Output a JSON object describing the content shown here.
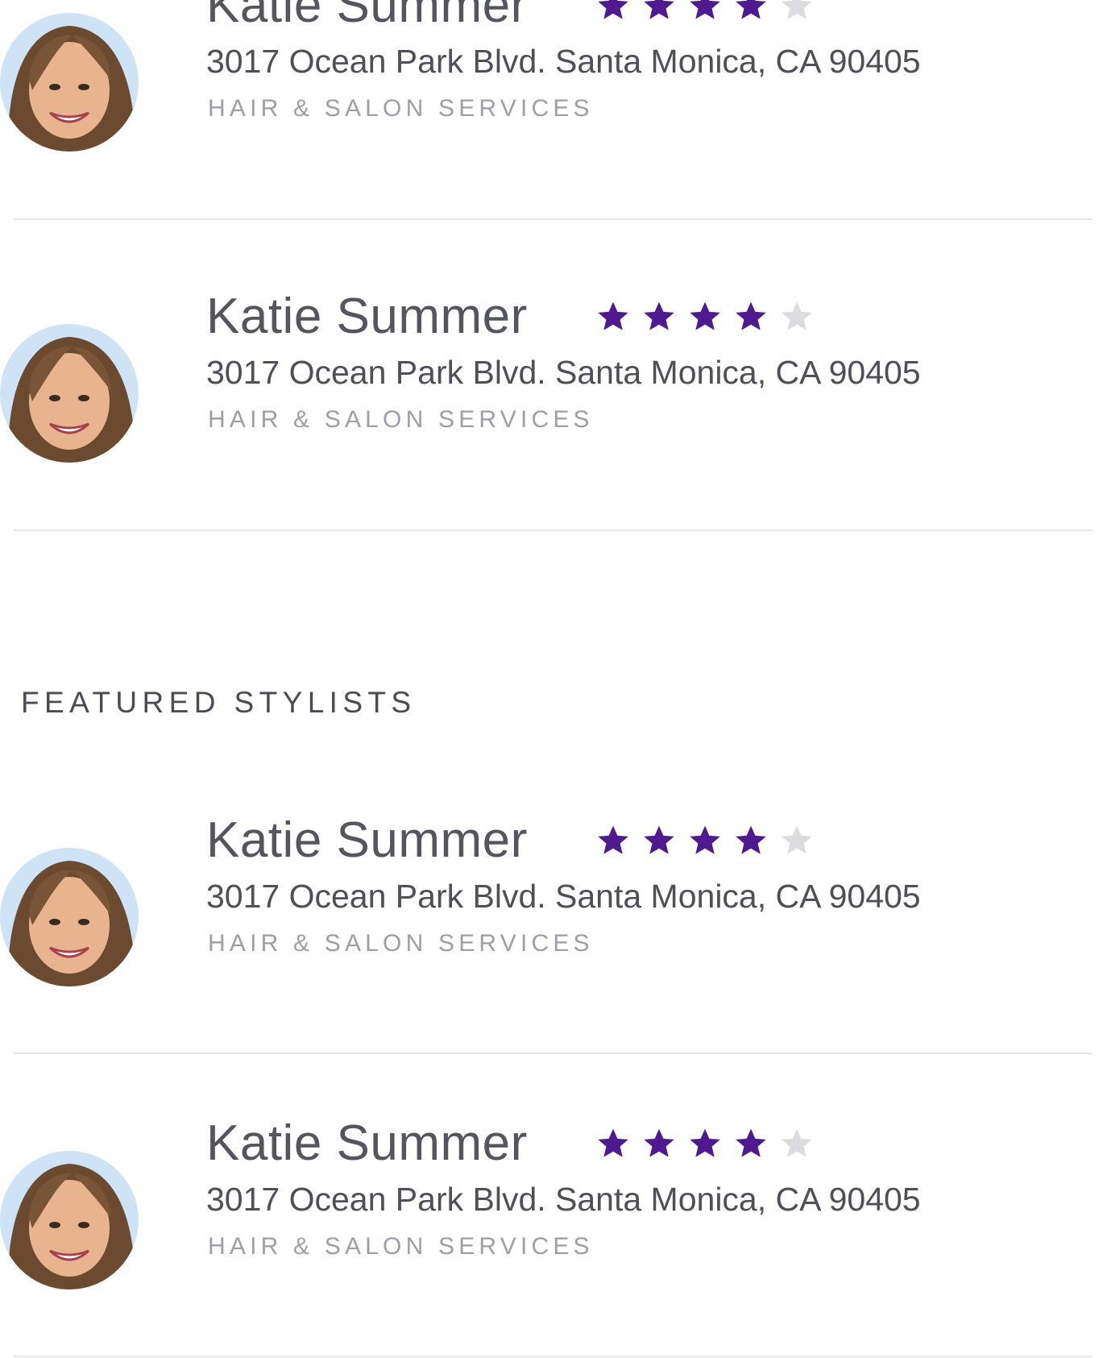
{
  "section_title": "FEATURED STYLISTS",
  "colors": {
    "star_filled": "#4f1990",
    "star_empty": "#dcdce0",
    "text_primary": "#55555e",
    "text_muted": "#9e9ea6",
    "divider": "#e6e6ea"
  },
  "top_list": {
    "items": [
      {
        "name": "Katie Summer",
        "rating": 4,
        "rating_max": 5,
        "address": "3017 Ocean Park Blvd. Santa Monica, CA 90405",
        "category": "HAIR & SALON SERVICES",
        "avatar_icon": "avatar-photo"
      },
      {
        "name": "Katie Summer",
        "rating": 4,
        "rating_max": 5,
        "address": "3017 Ocean Park Blvd. Santa Monica, CA 90405",
        "category": "HAIR & SALON SERVICES",
        "avatar_icon": "avatar-photo"
      }
    ]
  },
  "featured": {
    "items": [
      {
        "name": "Katie Summer",
        "rating": 4,
        "rating_max": 5,
        "address": "3017 Ocean Park Blvd. Santa Monica, CA 90405",
        "category": "HAIR & SALON SERVICES",
        "avatar_icon": "avatar-photo"
      },
      {
        "name": "Katie Summer",
        "rating": 4,
        "rating_max": 5,
        "address": "3017 Ocean Park Blvd. Santa Monica, CA 90405",
        "category": "HAIR & SALON SERVICES",
        "avatar_icon": "avatar-photo"
      }
    ]
  }
}
